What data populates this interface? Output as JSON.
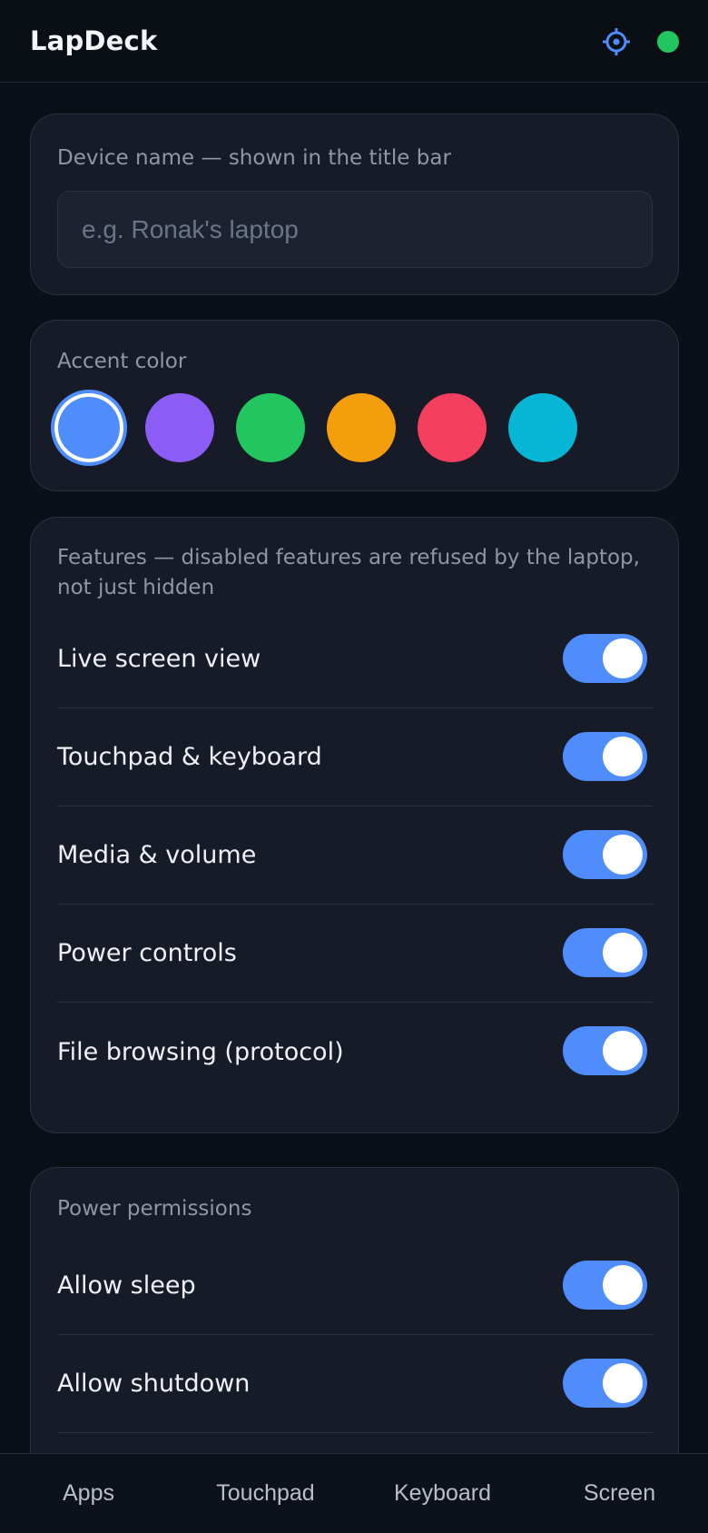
{
  "header": {
    "title": "LapDeck",
    "settings_icon": "gear-icon",
    "status_color": "#22c55e"
  },
  "device_name": {
    "label": "Device name — shown in the title bar",
    "placeholder": "e.g. Ronak's laptop",
    "value": ""
  },
  "accent": {
    "label": "Accent color",
    "selected_index": 0,
    "colors": [
      "#4f8dfc",
      "#8b5cf6",
      "#22c55e",
      "#f59e0b",
      "#f43f5e",
      "#06b6d4"
    ]
  },
  "features": {
    "label": "Features — disabled features are refused by the laptop, not just hidden",
    "label_line1": "Features — disabled features are refused by the laptop,",
    "label_line2": "not just hidden",
    "items": [
      {
        "label": "Live screen view",
        "enabled": true
      },
      {
        "label": "Touchpad & keyboard",
        "enabled": true
      },
      {
        "label": "Media & volume",
        "enabled": true
      },
      {
        "label": "Power controls",
        "enabled": true
      },
      {
        "label": "File browsing (protocol)",
        "enabled": true
      }
    ]
  },
  "power": {
    "label": "Power permissions",
    "items": [
      {
        "label": "Allow sleep",
        "enabled": true
      },
      {
        "label": "Allow shutdown",
        "enabled": true
      }
    ]
  },
  "tabs": [
    {
      "label": "Apps"
    },
    {
      "label": "Touchpad"
    },
    {
      "label": "Keyboard"
    },
    {
      "label": "Screen"
    }
  ],
  "theme": {
    "accent": "#4f8dfc",
    "background": "#0b0f17",
    "card": "#161b27"
  }
}
